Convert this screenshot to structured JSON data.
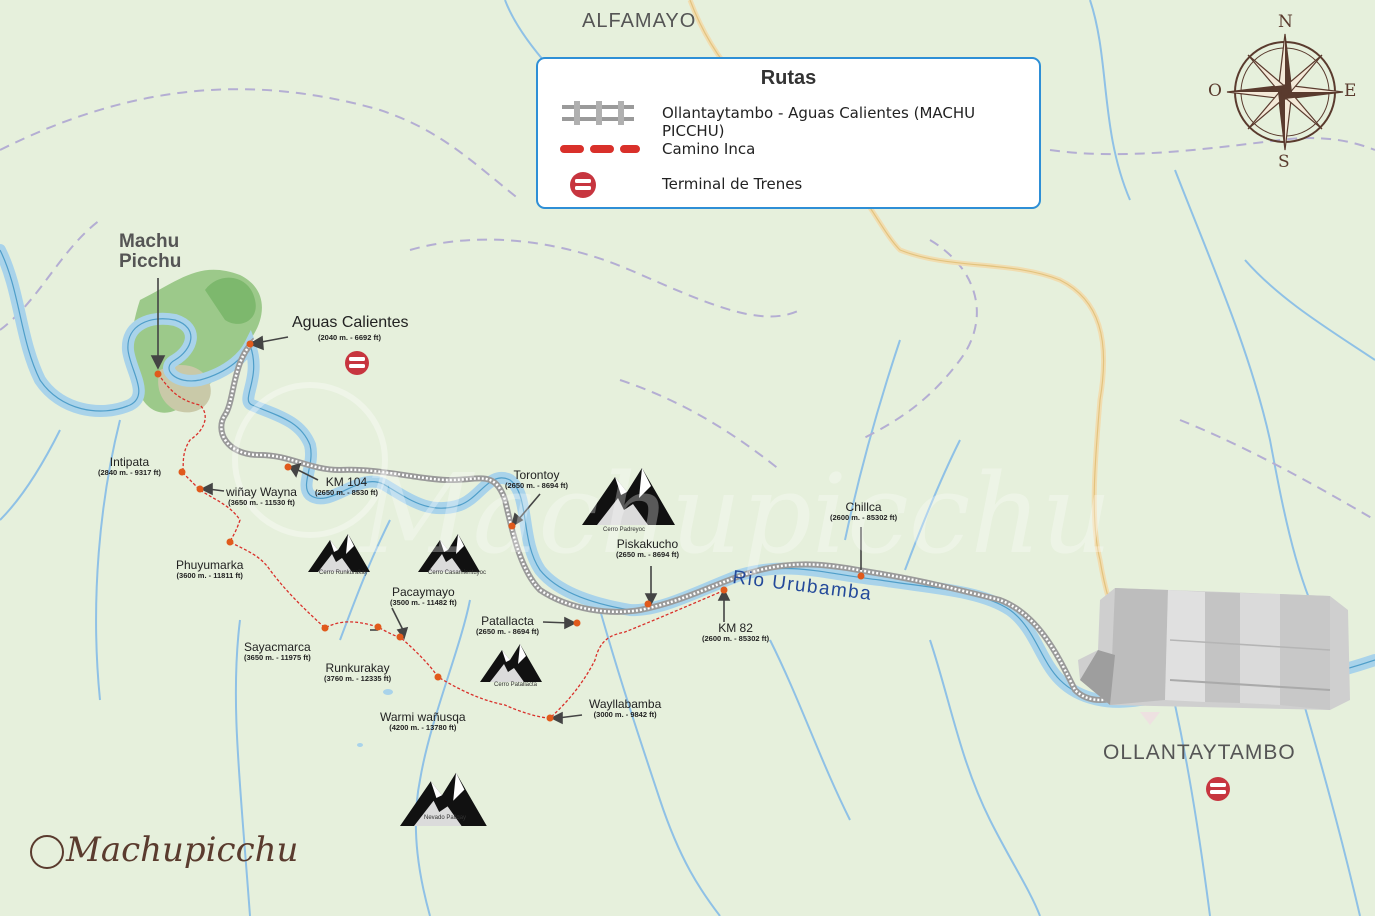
{
  "map": {
    "towns": {
      "alfamayo": "ALFAMAYO",
      "ollantaytambo": "OLLANTAYTAMBO"
    },
    "machu_picchu_title": "Machu Picchu",
    "aguas_calientes": {
      "name": "Aguas Calientes",
      "elevation": "(2040 m. - 6692 ft)"
    },
    "river_name": "Rio Urubamba",
    "brand": "Machupicchu",
    "watermark": "Machupicchu",
    "points": [
      {
        "name": "Intipata",
        "elevation": "(2840 m. - 9317 ft)"
      },
      {
        "name": "KM 104",
        "elevation": "(2650 m. - 8530 ft)"
      },
      {
        "name": "wiñay Wayna",
        "elevation": "(3650 m. - 11530 ft)"
      },
      {
        "name": "Phuyumarka",
        "elevation": "(3600 m. - 11811 ft)"
      },
      {
        "name": "Sayacmarca",
        "elevation": "(3650 m. - 11975 ft)"
      },
      {
        "name": "Runkurakay",
        "elevation": "(3760 m. - 12335 ft)"
      },
      {
        "name": "Pacaymayo",
        "elevation": "(3500 m. - 11482 ft)"
      },
      {
        "name": "Warmi wañusqa",
        "elevation": "(4200 m. - 13780 ft)"
      },
      {
        "name": "Patallacta",
        "elevation": "(2650 m. - 8694 ft)"
      },
      {
        "name": "Wayllabamba",
        "elevation": "(3000 m. - 9842 ft)"
      },
      {
        "name": "Torontoy",
        "elevation": "(2650 m. - 8694 ft)"
      },
      {
        "name": "Piskakucho",
        "elevation": "(2650 m. - 8694 ft)"
      },
      {
        "name": "KM 82",
        "elevation": "(2600 m. - 85302 ft)"
      },
      {
        "name": "Chillca",
        "elevation": "(2600 m. - 85302 ft)"
      }
    ],
    "mountains": [
      "Cerro Runkurakay",
      "Cerro Casamientuyoc",
      "Cerro Padreyoc",
      "Cerro Patallacta",
      "Nevado Pallqay"
    ]
  },
  "legend": {
    "title": "Rutas",
    "items": [
      {
        "label": "Ollantaytambo - Aguas Calientes (MACHU PICCHU)",
        "symbol": "rail-track-icon"
      },
      {
        "label": "Camino Inca",
        "symbol": "dashed-red-line-icon"
      },
      {
        "label": "Terminal de Trenes",
        "symbol": "train-terminal-icon"
      }
    ]
  },
  "compass": {
    "n": "N",
    "s": "S",
    "e": "E",
    "w": "O"
  },
  "colors": {
    "background": "#e6f0dc",
    "river": "#a9d3ea",
    "inca_trail": "#d9302a",
    "railway": "#9a9a9a",
    "legend_border": "#2e8fd6",
    "terminal": "#c7353f",
    "point": "#e05a1c"
  }
}
